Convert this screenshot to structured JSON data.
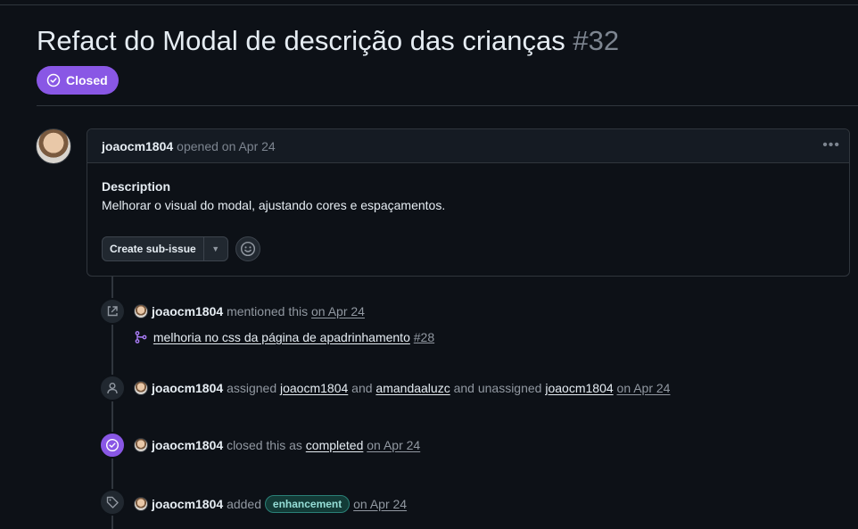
{
  "issue": {
    "title": "Refact do Modal de descrição das crianças",
    "number": "#32",
    "state": "Closed"
  },
  "comment": {
    "author": "joaocm1804",
    "meta": "opened on Apr 24",
    "heading": "Description",
    "body": "Melhorar o visual do modal, ajustando cores e espaçamentos.",
    "create_sub_issue_label": "Create sub-issue"
  },
  "timeline": {
    "mention": {
      "actor": "joaocm1804",
      "verb": "mentioned this",
      "date": "on Apr 24",
      "ref_title": "melhoria no css da página de apadrinhamento",
      "ref_number": "#28"
    },
    "assign": {
      "actor": "joaocm1804",
      "verb": "assigned",
      "user1": "joaocm1804",
      "and": "and",
      "user2": "amandaaluzc",
      "and_unassigned": "and unassigned",
      "user3": "joaocm1804",
      "date": "on Apr 24"
    },
    "close": {
      "actor": "joaocm1804",
      "verb": "closed this as",
      "reason": "completed",
      "date": "on Apr 24"
    },
    "label": {
      "actor": "joaocm1804",
      "verb": "added",
      "label_name": "enhancement",
      "date": "on Apr 24"
    }
  },
  "colors": {
    "background": "#0d1117",
    "closed_purple": "#8957e5",
    "label_bg": "#133b37",
    "label_text": "#96ded7"
  }
}
